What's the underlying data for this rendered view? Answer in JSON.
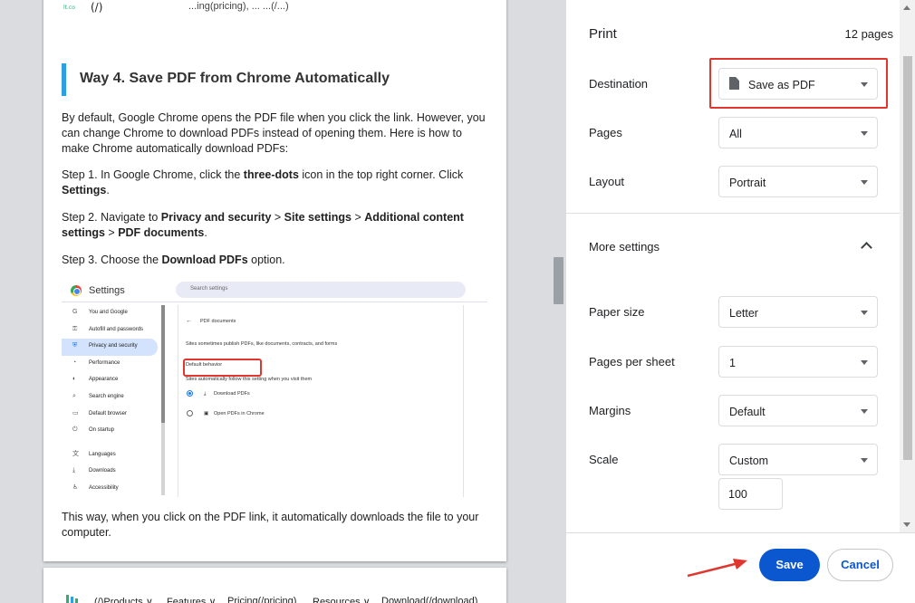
{
  "article": {
    "cut_text": "...ing(pricing), ... ...(/...)",
    "heading": "Way 4. Save PDF from Chrome Automatically",
    "para1": "By default, Google Chrome opens the PDF file when you click the link. However, you can change Chrome to download PDFs instead of opening them. Here is how to make Chrome automatically download PDFs:",
    "step1_pre": "Step 1. In Google Chrome, click the ",
    "step1_b1": "three-dots",
    "step1_mid": " icon in the top right corner. Click ",
    "step1_b2": "Settings",
    "step1_end": ".",
    "step2_pre": "Step 2. Navigate to ",
    "step2_b1": "Privacy and security",
    "step2_sep1": " > ",
    "step2_b2": "Site settings",
    "step2_sep2": " > ",
    "step2_b3": "Additional content settings",
    "step2_sep3": " > ",
    "step2_b4": "PDF documents",
    "step2_end": ".",
    "step3_pre": "Step 3. Choose the ",
    "step3_b1": "Download PDFs",
    "step3_end": " option.",
    "para_last": "This way, when you click on the PDF link, it automatically downloads the file to your computer.",
    "settings_shot": {
      "title": "Settings",
      "search_placeholder": "Search settings",
      "nav": [
        {
          "label": "You and Google",
          "icon": "G"
        },
        {
          "label": "Autofill and passwords",
          "icon": "⚿"
        },
        {
          "label": "Privacy and security",
          "icon": "⛨"
        },
        {
          "label": "Performance",
          "icon": "◔"
        },
        {
          "label": "Appearance",
          "icon": "◐"
        },
        {
          "label": "Search engine",
          "icon": "⌕"
        },
        {
          "label": "Default browser",
          "icon": "▭"
        },
        {
          "label": "On startup",
          "icon": "⏻"
        },
        {
          "label": "Languages",
          "icon": "文"
        },
        {
          "label": "Downloads",
          "icon": "⤓"
        },
        {
          "label": "Accessibility",
          "icon": "♿"
        }
      ],
      "back_label": "PDF documents",
      "desc": "Sites sometimes publish PDFs, like documents, contracts, and forms",
      "default_behavior": "Default behavior",
      "auto_follow": "Sites automatically follow this setting when you visit them",
      "option_download": "Download PDFs",
      "option_open": "Open PDFs in Chrome"
    },
    "nav2": [
      "(/)Products ∨",
      "Features ∨",
      "Pricing(/pricing)",
      "Resources ∨",
      "Download(/download)"
    ]
  },
  "print_panel": {
    "title": "Print",
    "page_count": "12 pages",
    "destination_label": "Destination",
    "destination_value": "Save as PDF",
    "pages_label": "Pages",
    "pages_value": "All",
    "layout_label": "Layout",
    "layout_value": "Portrait",
    "more_settings_label": "More settings",
    "paper_size_label": "Paper size",
    "paper_size_value": "Letter",
    "pages_per_sheet_label": "Pages per sheet",
    "pages_per_sheet_value": "1",
    "margins_label": "Margins",
    "margins_value": "Default",
    "scale_label": "Scale",
    "scale_value": "Custom",
    "scale_percent": "100",
    "save_label": "Save",
    "cancel_label": "Cancel"
  },
  "colors": {
    "accent": "#0b57d0",
    "annotation_red": "#e0362d",
    "heading_bar": "#2ba0e6"
  }
}
